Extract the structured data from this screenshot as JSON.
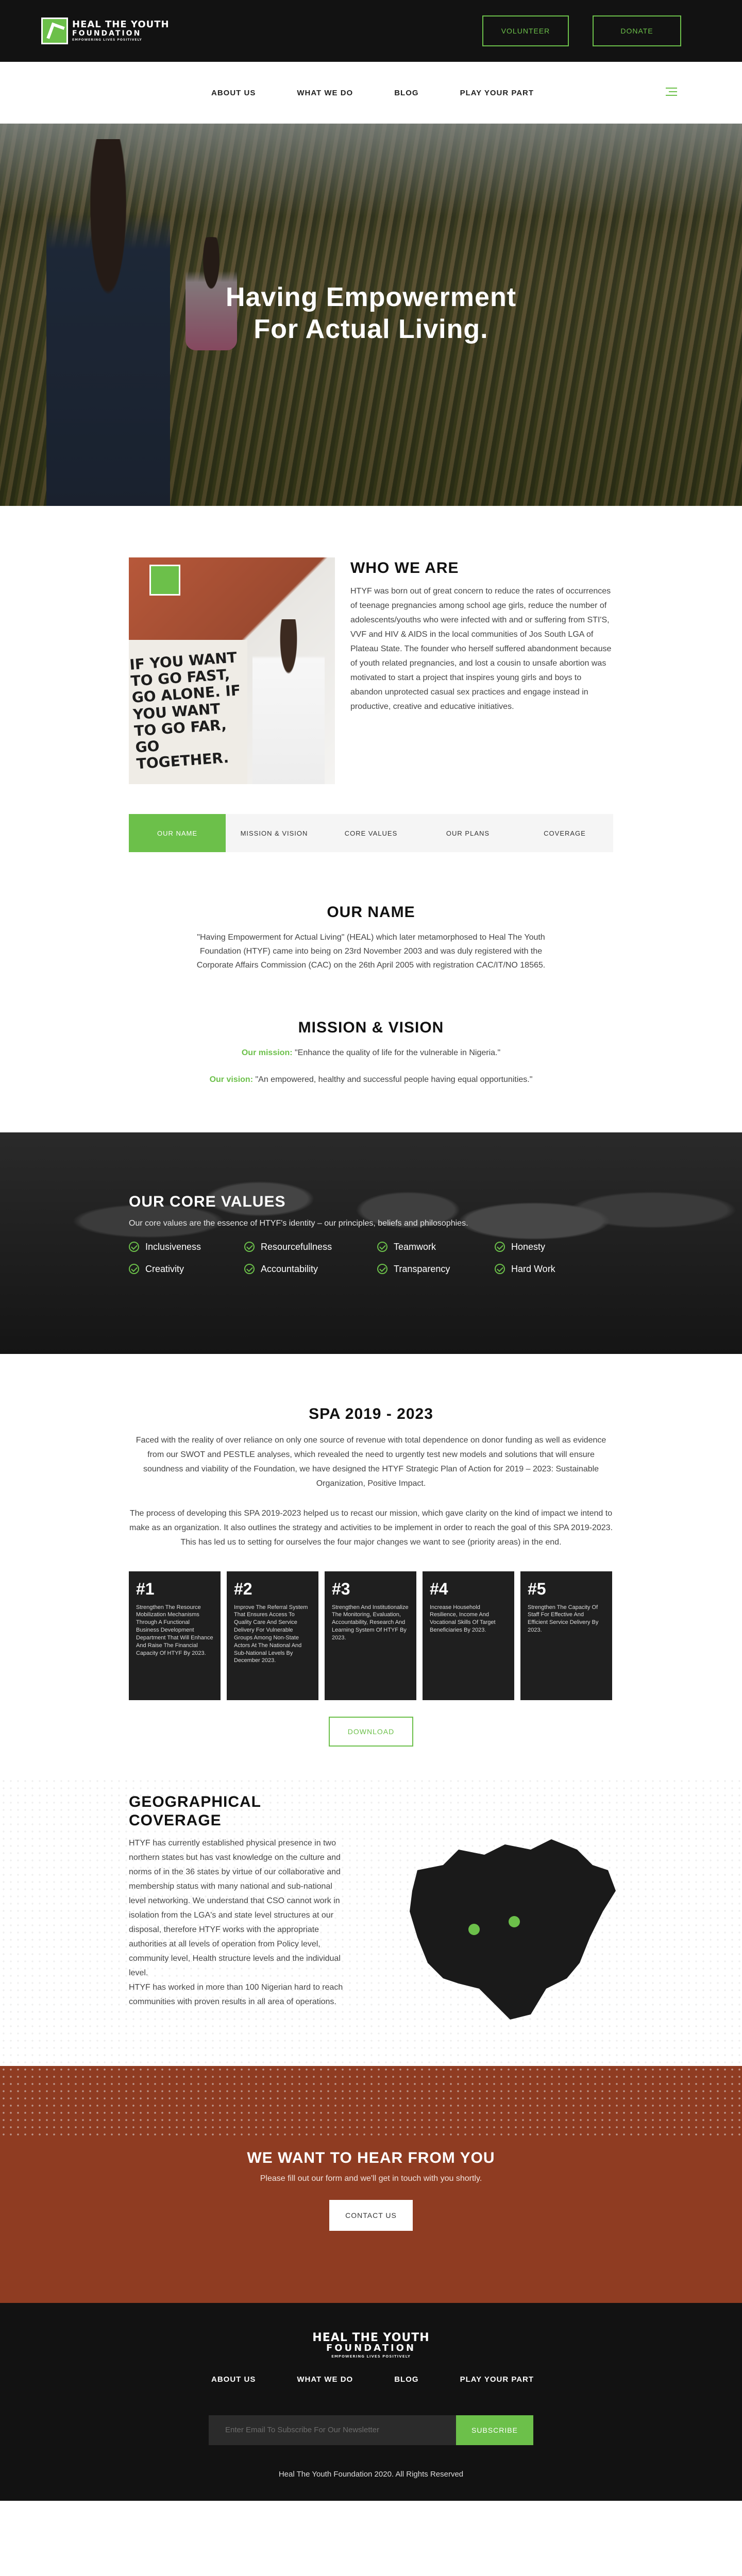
{
  "topbar": {
    "logo": {
      "line1": "HEAL THE YOUTH",
      "line2": "FOUNDATION",
      "tagline": "EMPOWERING LIVES POSITIVELY"
    },
    "volunteer_label": "VOLUNTEER",
    "donate_label": "DONATE"
  },
  "nav": {
    "items": [
      {
        "label": "ABOUT US"
      },
      {
        "label": "WHAT WE DO"
      },
      {
        "label": "BLOG"
      },
      {
        "label": "PLAY YOUR PART"
      }
    ]
  },
  "hero": {
    "title_line1": "Having Empowerment",
    "title_line2": "For Actual Living."
  },
  "who": {
    "heading": "WHO WE ARE",
    "body": "HTYF was born out of great concern to reduce the rates of occurrences of teenage pregnancies among school age girls, reduce the number of adolescents/youths who were infected with and or suffering from STI'S, VVF and HIV & AIDS in the local communities of Jos South LGA of Plateau State. The founder who herself suffered abandonment because of youth related pregnancies, and lost a cousin to unsafe abortion was motivated to start a project that inspires young girls and boys to abandon unprotected casual sex practices and engage instead in productive, creative and educative initiatives.",
    "photo_sign": "IF YOU WANT TO GO FAST, GO ALONE. IF YOU WANT TO GO FAR, GO TOGETHER."
  },
  "tabs": [
    {
      "label": "OUR NAME",
      "active": true
    },
    {
      "label": "MISSION & VISION"
    },
    {
      "label": "CORE VALUES"
    },
    {
      "label": "OUR PLANS"
    },
    {
      "label": "COVERAGE"
    }
  ],
  "our_name": {
    "heading": "OUR NAME",
    "body": "\"Having Empowerment for Actual Living\" (HEAL) which later metamorphosed to Heal The Youth Foundation (HTYF) came into being on 23rd November 2003 and was duly registered with the Corporate Affairs Commission (CAC) on the 26th April 2005 with registration CAC/IT/NO 18565."
  },
  "mission": {
    "heading": "MISSION & VISION",
    "mission_label": "Our mission:",
    "mission_text": " \"Enhance the quality of life for the vulnerable in Nigeria.\"",
    "vision_label": "Our vision:",
    "vision_text": " \"An empowered, healthy and successful people having equal opportunities.\""
  },
  "core": {
    "heading": "OUR CORE VALUES",
    "sub": "Our core values are the essence of HTYF's identity – our principles, beliefs and philosophies.",
    "values": [
      "Inclusiveness",
      "Resourcefullness",
      "Teamwork",
      "Honesty",
      "Creativity",
      "Accountability",
      "Transparency",
      "Hard Work"
    ]
  },
  "spa": {
    "heading": "SPA 2019 - 2023",
    "p1": "Faced with the reality of over reliance on only one source of revenue with total dependence on donor funding as well as evidence from our SWOT and PESTLE analyses, which revealed the need to urgently test new models and solutions that will ensure soundness and viability of the Foundation, we have designed the HTYF Strategic Plan of Action for 2019 – 2023: Sustainable Organization, Positive Impact.",
    "p2": "The process of developing this SPA 2019-2023 helped us to recast our mission, which gave clarity on the kind of impact we intend to make as an organization. It also outlines the strategy and activities to be implement in order to reach the goal of this SPA 2019-2023. This has led us to setting for ourselves the four major changes we want to see (priority areas) in the end.",
    "cards": [
      {
        "num": "#1",
        "text": "Strengthen The Resource Mobilization Mechanisms Through A Functional Business Development Department That Will Enhance And Raise The Financial Capacity Of HTYF By 2023."
      },
      {
        "num": "#2",
        "text": "Improve The Referral System That Ensures Access To Quality Care And Service Delivery For Vulnerable Groups Among Non-State Actors At The National And Sub-National Levels By December 2023."
      },
      {
        "num": "#3",
        "text": "Strengthen And Institutionalize The Monitoring, Evaluation, Accountability, Research And Learning System Of HTYF By 2023."
      },
      {
        "num": "#4",
        "text": "Increase Household Resilience, Income And Vocational Skills Of Target Beneficiaries By 2023."
      },
      {
        "num": "#5",
        "text": "Strengthen The Capacity Of Staff For Effective And Efficient Service Delivery By 2023."
      }
    ],
    "download_label": "DOWNLOAD"
  },
  "geo": {
    "heading_line1": "GEOGRAPHICAL",
    "heading_line2": "COVERAGE",
    "body1": "HTYF has currently established physical presence in two northern states but has vast knowledge on the culture and norms of in the 36 states by virtue of our collaborative and membership status with many national and sub-national level networking. We understand that CSO cannot work in isolation from the LGA's and state level structures at our disposal, therefore HTYF works with the appropriate authorities at all levels of operation from Policy level, community level, Health structure levels and the individual level.",
    "body2": "HTYF has worked in more than 100 Nigerian hard to reach communities with proven results in all area of operations.",
    "colors": {
      "map": "#1a1a1a",
      "marker": "#6cc04a"
    }
  },
  "contact": {
    "heading": "WE WANT TO HEAR FROM YOU",
    "sub": "Please fill out our form and we'll get in touch with you shortly.",
    "button_label": "CONTACT US"
  },
  "footer": {
    "logo": {
      "line1": "HEAL THE YOUTH",
      "line2": "FOUNDATION",
      "tagline": "EMPOWERING LIVES POSITIVELY"
    },
    "items": [
      {
        "label": "ABOUT US"
      },
      {
        "label": "WHAT WE DO"
      },
      {
        "label": "BLOG"
      },
      {
        "label": "PLAY YOUR PART"
      }
    ],
    "subscribe_placeholder": "Enter Email To Subscribe For Our Newsletter",
    "subscribe_label": "SUBSCRIBE",
    "copyright": "Heal The Youth Foundation 2020. All Rights Reserved"
  },
  "colors": {
    "accent": "#6cc04a",
    "dark": "#121212",
    "contact_bg": "#8f3c22"
  }
}
